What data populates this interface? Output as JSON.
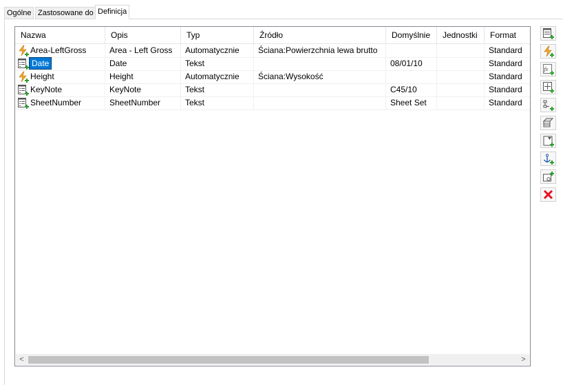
{
  "tabs": [
    {
      "label": "Ogólne",
      "active": false
    },
    {
      "label": "Zastosowane do",
      "active": false
    },
    {
      "label": "Definicja",
      "active": true
    }
  ],
  "table": {
    "columns": [
      "Nazwa",
      "Opis",
      "Typ",
      "Źródło",
      "Domyślnie",
      "Jednostki",
      "Format"
    ],
    "rows": [
      {
        "icon": "automatic-property-icon",
        "name": "Area-LeftGross",
        "description": "Area - Left Gross",
        "type": "Automatycznie",
        "source": "Ściana:Powierzchnia lewa brutto",
        "default": "",
        "units": "",
        "format": "Standard"
      },
      {
        "icon": "manual-property-icon",
        "name": "Date",
        "description": "Date",
        "type": "Tekst",
        "source": "",
        "default": "08/01/10",
        "units": "",
        "format": "Standard",
        "selected": true
      },
      {
        "icon": "automatic-property-icon",
        "name": "Height",
        "description": "Height",
        "type": "Automatycznie",
        "source": "Ściana:Wysokość",
        "default": "",
        "units": "",
        "format": "Standard"
      },
      {
        "icon": "manual-property-icon",
        "name": "KeyNote",
        "description": "KeyNote",
        "type": "Tekst",
        "source": "",
        "default": "C45/10",
        "units": "",
        "format": "Standard"
      },
      {
        "icon": "manual-property-icon",
        "name": "SheetNumber",
        "description": "SheetNumber",
        "type": "Tekst",
        "source": "",
        "default": "Sheet Set",
        "units": "",
        "format": "Standard"
      }
    ]
  },
  "scrollbar": {
    "left_arrow": "<",
    "right_arrow": ">"
  },
  "toolbar": {
    "buttons": [
      "add-manual-property-icon",
      "add-automatic-property-icon",
      "add-formula-property-icon",
      "add-location-property-icon",
      "add-classification-property-icon",
      "add-material-property-icon",
      "add-graphic-property-icon",
      "add-anchor-property-icon",
      "add-property-set-data-icon",
      "delete-icon"
    ]
  },
  "colors": {
    "selection": "#0078d7",
    "automatic_icon": "#f5a623",
    "add_plus": "#2e9e2e",
    "delete": "#e81123"
  }
}
